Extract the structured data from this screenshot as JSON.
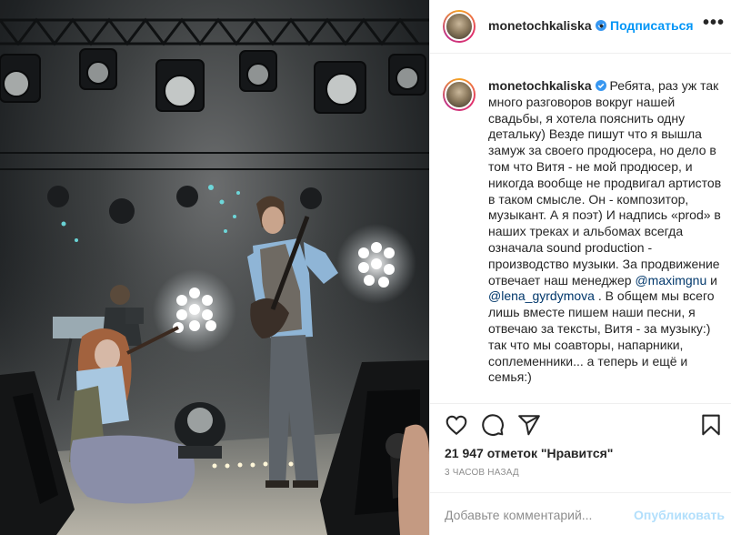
{
  "post": {
    "image_alt": "Concert photo: singer sitting on stage, guitarist standing, keyboard player in background",
    "header": {
      "username": "monetochkaliska",
      "separator": "•",
      "follow_label": "Подписаться",
      "more_label": "•••"
    },
    "caption": {
      "username": "monetochkaliska",
      "text_before": "Ребята, раз уж так много разговоров вокруг нашей свадьбы, я хотела пояснить одну детальку) Везде пишут что я вышла замуж за своего продюсера, но дело в том что Витя - не мой продюсер, и никогда вообще не продвигал артистов в таком смысле. Он - композитор, музыкант. А я поэт) И надпись «prod» в наших треках и альбомах всегда означала sound production - производство музыки. За продвижение отвечает наш менеджер ",
      "mention_1": "@maximgnu",
      "text_between": " и ",
      "mention_2": "@lena_gyrdymova",
      "text_after": " . В общем мы всего лишь вместе пишем наши песни, я отвечаю за тексты, Витя - за музыку:) так что мы соавторы, напарники, соплеменники... а теперь и ещё и семья:)"
    },
    "actions": {
      "like_icon": "heart-icon",
      "comment_icon": "comment-icon",
      "share_icon": "paper-plane-icon",
      "save_icon": "bookmark-icon"
    },
    "likes_text": "21 947 отметок \"Нравится\"",
    "timestamp": "3 ЧАСОВ НАЗАД",
    "add_comment": {
      "placeholder": "Добавьте комментарий...",
      "publish_label": "Опубликовать"
    }
  },
  "colors": {
    "accent": "#0095f6",
    "mention": "#00376b",
    "publish_disabled": "#b2dffc",
    "muted": "#8e8e8e",
    "verified": "#3897f0"
  }
}
